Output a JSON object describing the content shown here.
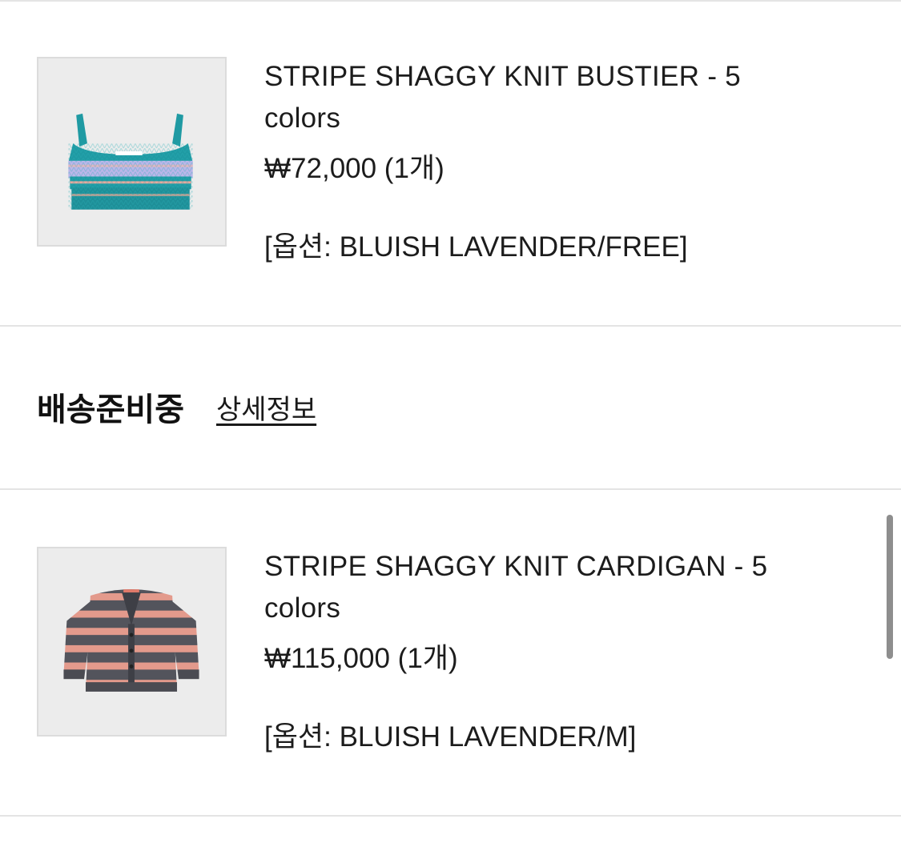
{
  "order_items": [
    {
      "name": "STRIPE SHAGGY KNIT BUSTIER - 5 colors",
      "price": "₩72,000 (1개)",
      "option": "[옵션: BLUISH LAVENDER/FREE]",
      "image_icon": "knit-bustier-image"
    },
    {
      "name": "STRIPE SHAGGY KNIT CARDIGAN - 5 colors",
      "price": "₩115,000 (1개)",
      "option": "[옵션: BLUISH LAVENDER/M]",
      "image_icon": "knit-cardigan-image"
    }
  ],
  "shipment": {
    "status": "배송준비중",
    "detail_link": "상세정보"
  },
  "colors": {
    "divider": "#e4e4e4",
    "thumb_bg": "#ececec",
    "text": "#1c1c1c",
    "bustier_teal": "#1f9aa3",
    "bustier_lavender": "#bdb6ea",
    "cardigan_gray": "#53545c",
    "cardigan_pink": "#e39a8c"
  }
}
